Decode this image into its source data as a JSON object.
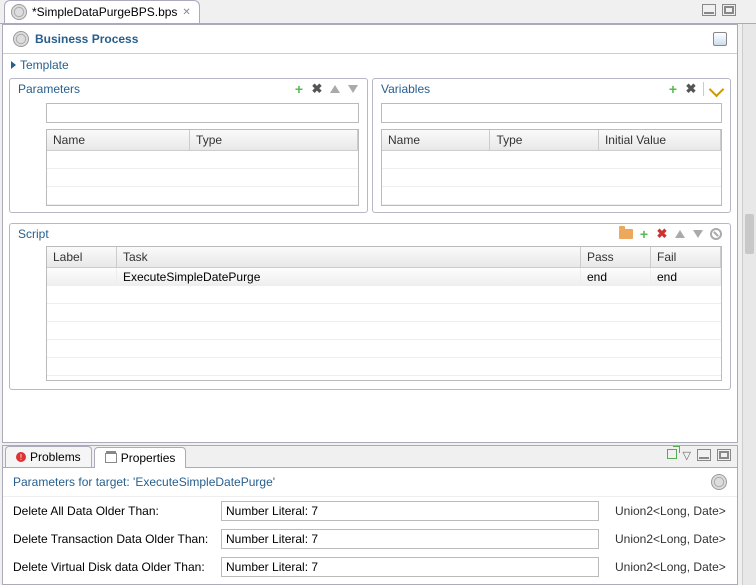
{
  "editor_tab": {
    "title": "*SimpleDataPurgeBPS.bps"
  },
  "form": {
    "title": "Business Process",
    "template_section": "Template",
    "parameters": {
      "title": "Parameters",
      "columns": {
        "name": "Name",
        "type": "Type"
      },
      "rows": []
    },
    "variables": {
      "title": "Variables",
      "columns": {
        "name": "Name",
        "type": "Type",
        "initial": "Initial Value"
      },
      "rows": []
    },
    "script": {
      "title": "Script",
      "columns": {
        "label": "Label",
        "task": "Task",
        "pass": "Pass",
        "fail": "Fail"
      },
      "rows": [
        {
          "label": "",
          "task": "ExecuteSimpleDatePurge",
          "pass": "end",
          "fail": "end"
        }
      ]
    }
  },
  "bottom": {
    "tabs": {
      "problems": "Problems",
      "properties": "Properties"
    },
    "subtitle": "Parameters for target: 'ExecuteSimpleDatePurge'",
    "fields": [
      {
        "label": "Delete All Data Older Than:",
        "value": "Number Literal: 7",
        "type": "Union2<Long, Date>"
      },
      {
        "label": "Delete Transaction Data Older Than:",
        "value": "Number Literal: 7",
        "type": "Union2<Long, Date>"
      },
      {
        "label": "Delete Virtual Disk data Older Than:",
        "value": "Number Literal: 7",
        "type": "Union2<Long, Date>"
      }
    ]
  }
}
